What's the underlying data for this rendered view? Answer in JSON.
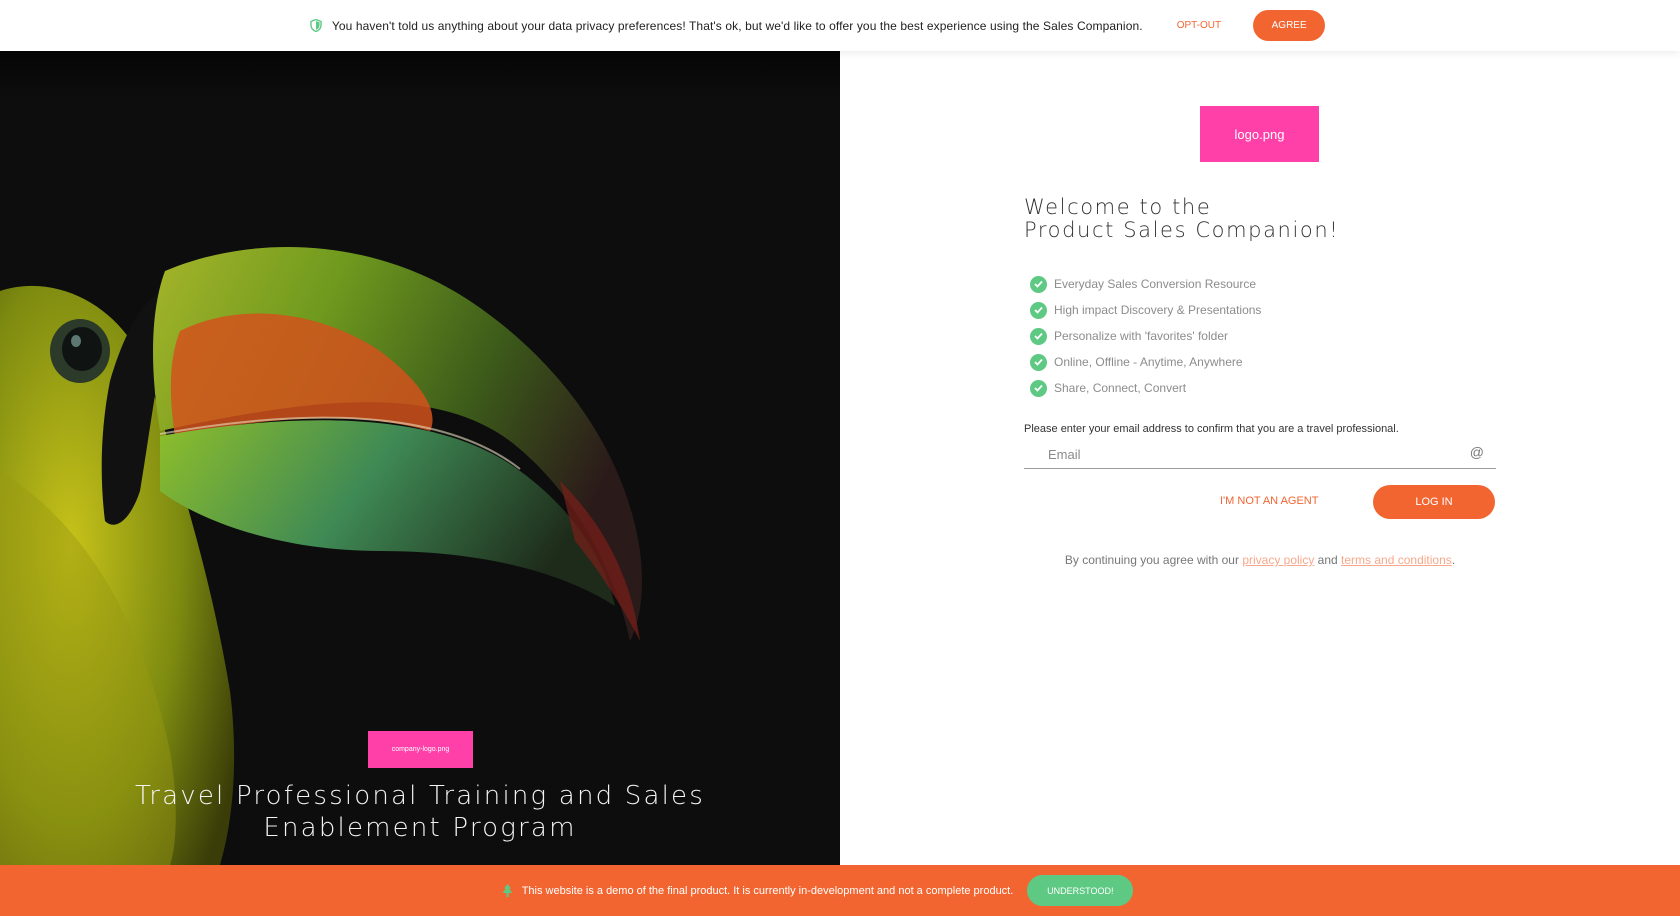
{
  "privacy_banner": {
    "message": "You haven't told us anything about your data privacy preferences! That's ok, but we'd like to offer you the best experience using the Sales Companion.",
    "optout_label": "OPT-OUT",
    "agree_label": "AGREE",
    "icon": "shield-icon"
  },
  "hero": {
    "company_logo_text": "company-logo.png",
    "title": "Travel Professional Training and Sales Enablement Program"
  },
  "login": {
    "logo_text": "logo.png",
    "welcome_line1": "Welcome to the",
    "welcome_line2": "Product Sales Companion!",
    "features": [
      {
        "label": "Everyday Sales Conversion Resource"
      },
      {
        "label": "High impact Discovery & Presentations"
      },
      {
        "label": "Personalize with 'favorites' folder"
      },
      {
        "label": "Online, Offline - Anytime, Anywhere"
      },
      {
        "label": "Share, Connect, Convert"
      }
    ],
    "prompt": "Please enter your email address to confirm that you are a travel professional.",
    "email_placeholder": "Email",
    "email_icon": "@",
    "not_agent_label": "I'M NOT AN AGENT",
    "login_label": "LOG IN",
    "legal_prefix": "By continuing you agree with our ",
    "privacy_link": "privacy policy",
    "legal_and": " and ",
    "terms_link": "terms and conditions",
    "legal_suffix": "."
  },
  "demo_banner": {
    "message": "This website is a demo of the final product. It is currently in-development and not a complete product.",
    "button_label": "UNDERSTOOD!",
    "icon": "tree-icon"
  },
  "colors": {
    "accent": "#f26531",
    "success": "#5ec983",
    "placeholder_logo": "#ff40a8"
  }
}
